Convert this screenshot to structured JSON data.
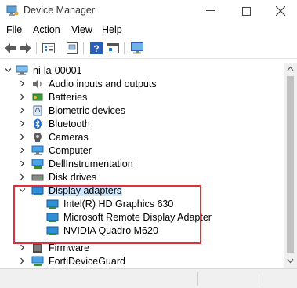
{
  "window": {
    "title": "Device Manager"
  },
  "menu": [
    "File",
    "Action",
    "View",
    "Help"
  ],
  "toolbar": [
    "back-icon",
    "forward-icon",
    "properties-icon",
    "update-icon",
    "help-icon",
    "view-icon",
    "scan-icon"
  ],
  "tree": {
    "root": "ni-la-00001",
    "items": [
      {
        "label": "Audio inputs and outputs",
        "icon": "speaker-icon",
        "expanded": false
      },
      {
        "label": "Batteries",
        "icon": "battery-icon",
        "expanded": false
      },
      {
        "label": "Biometric devices",
        "icon": "fingerprint-icon",
        "expanded": false
      },
      {
        "label": "Bluetooth",
        "icon": "bluetooth-icon",
        "expanded": false
      },
      {
        "label": "Cameras",
        "icon": "camera-icon",
        "expanded": false
      },
      {
        "label": "Computer",
        "icon": "computer-icon",
        "expanded": false
      },
      {
        "label": "DellInstrumentation",
        "icon": "device-icon",
        "expanded": false
      },
      {
        "label": "Disk drives",
        "icon": "disk-icon",
        "expanded": false
      },
      {
        "label": "Display adapters",
        "icon": "display-adapter-icon",
        "expanded": true,
        "selected": true,
        "children": [
          "Intel(R) HD Graphics 630",
          "Microsoft Remote Display Adapter",
          "NVIDIA Quadro M620"
        ]
      },
      {
        "label": "Firmware",
        "icon": "firmware-icon",
        "expanded": false
      },
      {
        "label": "FortiDeviceGuard",
        "icon": "device-icon",
        "expanded": false
      }
    ]
  },
  "colors": {
    "highlight": "#e0323c",
    "selection": "#cce8ff",
    "icon_blue": "#1e78c8"
  }
}
